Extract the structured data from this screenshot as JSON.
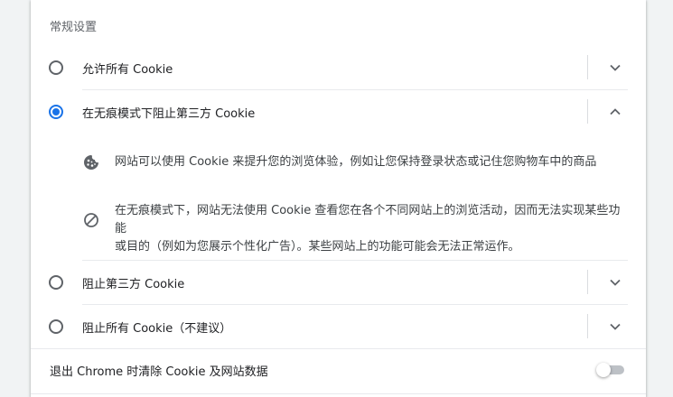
{
  "section": {
    "title": "常规设置"
  },
  "options": [
    {
      "label": "允许所有 Cookie",
      "selected": false,
      "expanded": false
    },
    {
      "label": "在无痕模式下阻止第三方 Cookie",
      "selected": true,
      "expanded": true
    },
    {
      "label": "阻止第三方 Cookie",
      "selected": false,
      "expanded": false
    },
    {
      "label": "阻止所有 Cookie（不建议）",
      "selected": false,
      "expanded": false
    }
  ],
  "details": {
    "cookie_info": "网站可以使用 Cookie 来提升您的浏览体验，例如让您保持登录状态或记住您购物车中的商品",
    "block_info_line1": "在无痕模式下，网站无法使用 Cookie 查看您在各个不同网站上的浏览活动，因而无法实现某些功能",
    "block_info_line2": "或目的（例如为您展示个性化广告）。某些网站上的功能可能会无法正常运作。"
  },
  "clear_on_exit": {
    "label": "退出 Chrome 时清除 Cookie 及网站数据",
    "enabled": false
  },
  "colors": {
    "accent": "#1a73e8",
    "icon": "#5f6368",
    "divider": "#e8eaed"
  }
}
